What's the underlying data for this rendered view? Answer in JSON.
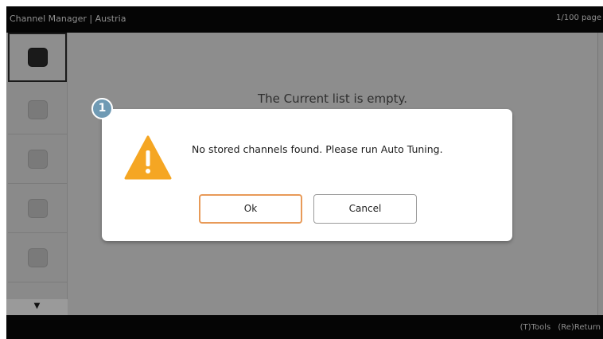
{
  "header": {
    "title": "Channel Manager | Austria",
    "page_indicator": "1/100 page"
  },
  "list": {
    "empty_message": "The Current list is empty.",
    "scroll_down_glyph": "▼"
  },
  "footer": {
    "tools_hint": "(T)Tools",
    "return_hint": "(Re)Return"
  },
  "dialog": {
    "step_badge": "1",
    "icon": "warning-triangle-icon",
    "message": "No stored channels found. Please run Auto Tuning.",
    "ok_label": "Ok",
    "cancel_label": "Cancel"
  },
  "colors": {
    "ok_focus_border": "#e89a58",
    "warning_icon": "#f5a623",
    "badge": "#6f9ab4"
  }
}
